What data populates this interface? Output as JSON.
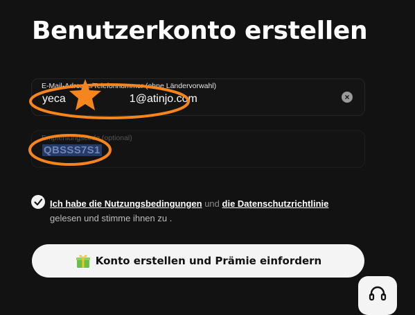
{
  "page": {
    "title": "Benutzerkonto erstellen"
  },
  "email_field": {
    "label": "E-Mail-Adresse/Telefonnummer (ohne Ländervorwahl)",
    "value_prefix": "yeca",
    "value_suffix": "1@atinjo.com",
    "clear_icon": "clear-icon"
  },
  "referral_field": {
    "label": "Empfehlungscode (optional)",
    "value": "QBSSS7S1"
  },
  "consent": {
    "terms_link": "Ich habe die Nutzungsbedingungen",
    "and_text": "und",
    "privacy_link": "die Datenschutzrichtlinie",
    "suffix": "gelesen und stimme ihnen zu ."
  },
  "submit_button": {
    "label": "Konto erstellen und Prämie einfordern",
    "icon": "gift-icon"
  },
  "support_button": {
    "icon": "headset-icon"
  },
  "colors": {
    "background": "#121212",
    "annotation": "#F7851E",
    "selection": "#263A66"
  }
}
